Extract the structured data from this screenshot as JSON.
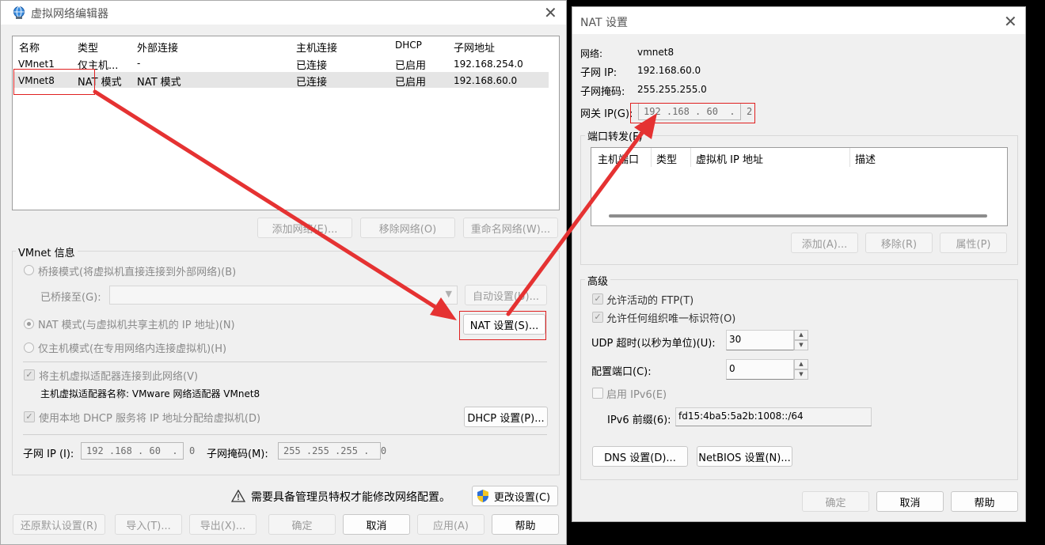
{
  "editor": {
    "title": "虚拟网络编辑器",
    "columns": [
      "名称",
      "类型",
      "外部连接",
      "主机连接",
      "DHCP",
      "子网地址"
    ],
    "rows": [
      [
        "VMnet1",
        "仅主机...",
        "-",
        "已连接",
        "已启用",
        "192.168.254.0"
      ],
      [
        "VMnet8",
        "NAT 模式",
        "NAT 模式",
        "已连接",
        "已启用",
        "192.168.60.0"
      ]
    ],
    "btn_add_network": "添加网络(E)...",
    "btn_remove_network": "移除网络(O)",
    "btn_rename_network": "重命名网络(W)...",
    "vmnet_info_label": "VMnet 信息",
    "bridge_mode": "桥接模式(将虚拟机直接连接到外部网络)(B)",
    "bridged_to_label": "已桥接至(G):",
    "btn_auto_settings": "自动设置(U)...",
    "nat_mode": "NAT 模式(与虚拟机共享主机的 IP 地址)(N)",
    "btn_nat_settings": "NAT 设置(S)...",
    "host_only_mode": "仅主机模式(在专用网络内连接虚拟机)(H)",
    "connect_adapter": "将主机虚拟适配器连接到此网络(V)",
    "adapter_name": "主机虚拟适配器名称: VMware 网络适配器 VMnet8",
    "use_dhcp": "使用本地 DHCP 服务将 IP 地址分配给虚拟机(D)",
    "btn_dhcp_settings": "DHCP 设置(P)...",
    "subnet_ip_label": "子网 IP (I):",
    "subnet_ip_value": "192 .168 . 60  .  0",
    "subnet_mask_label": "子网掩码(M):",
    "subnet_mask_value": "255 .255 .255 .  0",
    "admin_warning": "需要具备管理员特权才能修改网络配置。",
    "btn_change_settings": "更改设置(C)",
    "btn_restore_defaults": "还原默认设置(R)",
    "btn_import": "导入(T)...",
    "btn_export": "导出(X)...",
    "btn_ok": "确定",
    "btn_cancel": "取消",
    "btn_apply": "应用(A)",
    "btn_help": "帮助"
  },
  "nat": {
    "title": "NAT 设置",
    "network_label": "网络:",
    "network_value": "vmnet8",
    "subnet_ip_label": "子网 IP:",
    "subnet_ip_value": "192.168.60.0",
    "subnet_mask_label": "子网掩码:",
    "subnet_mask_value": "255.255.255.0",
    "gateway_label": "网关 IP(G):",
    "gateway_value": "192 .168 . 60  .  2",
    "port_forwarding_label": "端口转发(F)",
    "pf_columns": [
      "主机端口",
      "类型",
      "虚拟机 IP 地址",
      "描述"
    ],
    "btn_add": "添加(A)...",
    "btn_remove": "移除(R)",
    "btn_properties": "属性(P)",
    "advanced_label": "高级",
    "allow_active_ftp": "允许活动的 FTP(T)",
    "allow_any_oui": "允许任何组织唯一标识符(O)",
    "udp_timeout_label": "UDP 超时(以秒为单位)(U):",
    "udp_timeout_value": "30",
    "config_port_label": "配置端口(C):",
    "config_port_value": "0",
    "enable_ipv6": "启用 IPv6(E)",
    "ipv6_prefix_label": "IPv6 前缀(6):",
    "ipv6_prefix_value": "fd15:4ba5:5a2b:1008::/64",
    "btn_dns": "DNS 设置(D)...",
    "btn_netbios": "NetBIOS 设置(N)...",
    "btn_ok": "确定",
    "btn_cancel": "取消",
    "btn_help": "帮助"
  },
  "colors": {
    "annotation_red": "#e02020"
  }
}
